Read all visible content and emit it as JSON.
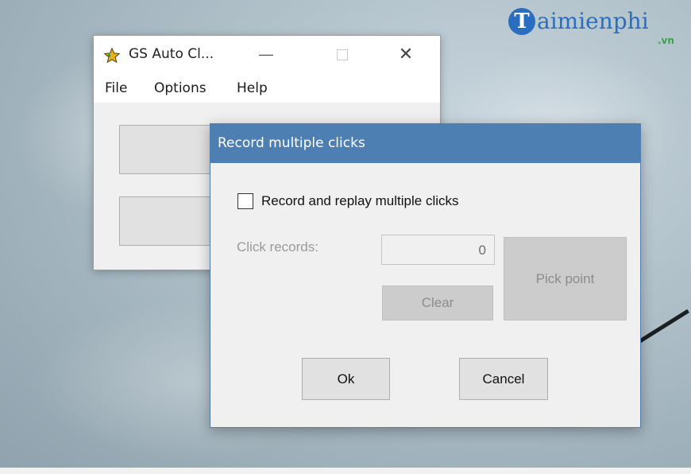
{
  "watermark": {
    "glyph": "T",
    "text": "aimienphi",
    "sub": ".vn"
  },
  "main_window": {
    "title": "GS Auto Cl...",
    "controls": {
      "minimize": "—",
      "close": "✕"
    },
    "menu": [
      "File",
      "Options",
      "Help"
    ],
    "icon": "star-icon"
  },
  "dialog": {
    "title": "Record multiple clicks",
    "checkbox_label": "Record and replay multiple clicks",
    "checkbox_checked": false,
    "click_records_label": "Click records:",
    "click_records_value": "0",
    "clear_label": "Clear",
    "pick_point_label": "Pick point",
    "ok_label": "Ok",
    "cancel_label": "Cancel"
  },
  "colors": {
    "dialog_title_bar": "#4e7fb3",
    "watermark_blue": "#2a6fbf",
    "watermark_green": "#3aa14a"
  }
}
